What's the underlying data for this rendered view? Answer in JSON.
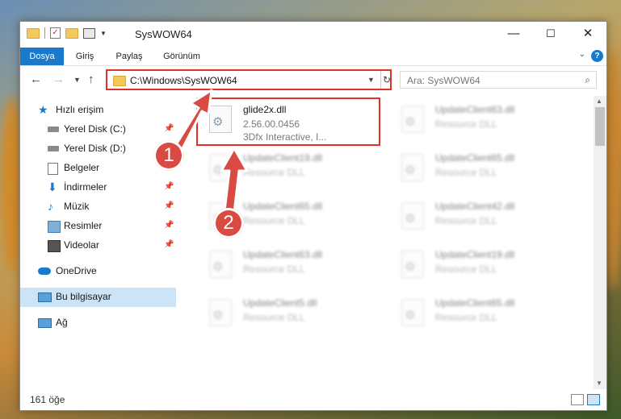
{
  "window": {
    "title": "SysWOW64",
    "minimize": "—",
    "maximize": "☐",
    "close": "✕"
  },
  "ribbon": {
    "tabs": [
      "Dosya",
      "Giriş",
      "Paylaş",
      "Görünüm"
    ],
    "help": "?"
  },
  "address": {
    "path": "C:\\Windows\\SysWOW64",
    "search_placeholder": "Ara: SysWOW64"
  },
  "sidebar": {
    "items": [
      {
        "label": "Hızlı erişim",
        "icon": "star-icon"
      },
      {
        "label": "Yerel Disk (C:)",
        "icon": "drive-icon"
      },
      {
        "label": "Yerel Disk (D:)",
        "icon": "drive-icon"
      },
      {
        "label": "Belgeler",
        "icon": "documents-icon"
      },
      {
        "label": "İndirmeler",
        "icon": "download-icon"
      },
      {
        "label": "Müzik",
        "icon": "music-icon"
      },
      {
        "label": "Resimler",
        "icon": "pictures-icon"
      },
      {
        "label": "Videolar",
        "icon": "video-icon"
      },
      {
        "label": "OneDrive",
        "icon": "cloud-icon"
      },
      {
        "label": "Bu bilgisayar",
        "icon": "computer-icon"
      },
      {
        "label": "Ağ",
        "icon": "network-icon"
      }
    ]
  },
  "files": [
    {
      "name": "glide2x.dll",
      "sub": "2.56.00.0456",
      "sub2": "3Dfx Interactive, I..."
    },
    {
      "name": "UpdateClient63.dll",
      "sub": "Resource DLL"
    },
    {
      "name": "UpdateClient19.dll",
      "sub": "Resource DLL"
    },
    {
      "name": "UpdateClient65.dll",
      "sub": "Resource DLL"
    },
    {
      "name": "UpdateClient65.dll",
      "sub": "Resource DLL"
    },
    {
      "name": "UpdateClient42.dll",
      "sub": "Resource DLL"
    },
    {
      "name": "UpdateClient63.dll",
      "sub": "Resource DLL"
    },
    {
      "name": "UpdateClient19.dll",
      "sub": "Resource DLL"
    },
    {
      "name": "UpdateClient5.dll",
      "sub": "Resource DLL"
    },
    {
      "name": "UpdateClient65.dll",
      "sub": "Resource DLL"
    }
  ],
  "status": {
    "count": "161 öğe"
  },
  "annotations": {
    "step1": "1",
    "step2": "2"
  },
  "colors": {
    "accent": "#1979ca",
    "highlight": "#e0302a",
    "badge": "#d94a43"
  }
}
